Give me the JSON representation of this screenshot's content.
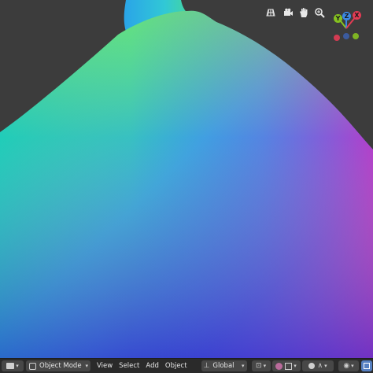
{
  "header": {
    "mode_label": "Object Mode",
    "menus": [
      "View",
      "Select",
      "Add",
      "Object"
    ],
    "orientation_label": "Global"
  },
  "gizmo": {
    "x_label": "X",
    "y_label": "Y",
    "z_label": "Z",
    "x_color": "#e33b54",
    "y_color": "#86c220",
    "z_color": "#3b88e3"
  },
  "icons": {
    "nav": [
      "grid-icon",
      "camera-icon",
      "hand-icon",
      "zoom-icon"
    ],
    "header": [
      "viewport-editor-icon",
      "object-mode-icon",
      "transform-orientation-icon",
      "pivot-icon",
      "snap-icon",
      "proportional-edit-icon",
      "shading-icon"
    ]
  },
  "colors": {
    "background": "#3c3c3c",
    "header": "#2a2a2a",
    "button": "#474747"
  }
}
